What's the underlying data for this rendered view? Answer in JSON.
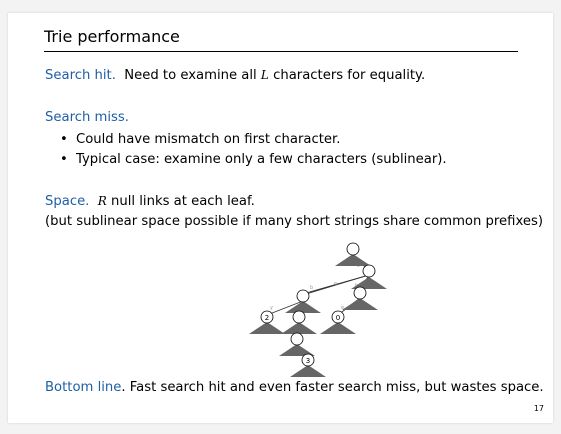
{
  "slide": {
    "title": "Trie performance",
    "page_number": "17",
    "search_hit": {
      "label": "Search hit.",
      "text_a": "Need to examine all",
      "var": "L",
      "text_b": "characters for equality."
    },
    "search_miss": {
      "label": "Search miss.",
      "bullets": [
        "Could have mismatch on first character.",
        "Typical case:  examine only a few characters (sublinear)."
      ]
    },
    "space": {
      "label": "Space.",
      "var": "R",
      "text": "null links at each leaf.",
      "note": "(but sublinear space possible if many short strings share common prefixes)"
    },
    "bottom_line": {
      "label": "Bottom line",
      "text": ".  Fast search hit and even faster search miss, but wastes space."
    },
    "diagram": {
      "node_values": [
        "2",
        "0",
        "3"
      ],
      "colors": {
        "accent": "#1f5fa6",
        "node_fill": "#ffffff",
        "shadow": "#666666"
      }
    }
  }
}
